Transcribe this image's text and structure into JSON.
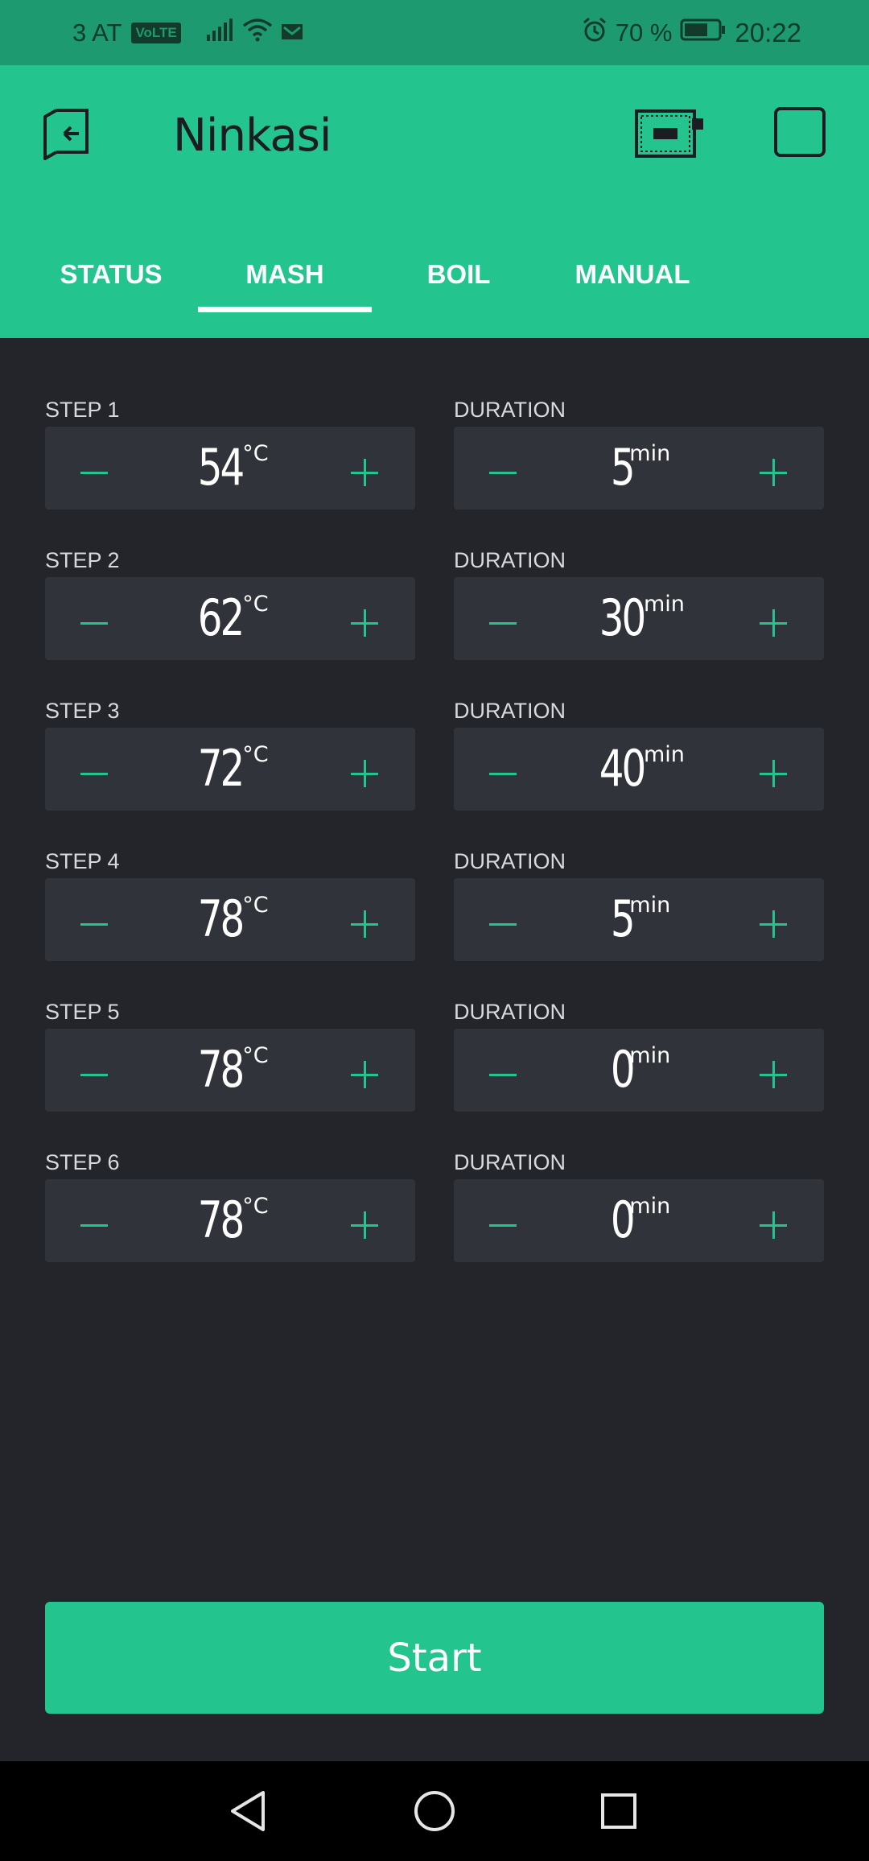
{
  "status_bar": {
    "carrier": "3 AT",
    "volte": "VoLTE",
    "battery": "70 %",
    "time": "20:22"
  },
  "header": {
    "title": "Ninkasi",
    "icons": [
      "exit-icon",
      "device-board-icon",
      "square-icon"
    ]
  },
  "tabs": [
    {
      "label": "STATUS"
    },
    {
      "label": "MASH"
    },
    {
      "label": "BOIL"
    },
    {
      "label": "MANUAL"
    }
  ],
  "active_tab": "MASH",
  "steps": [
    {
      "label": "STEP 1",
      "temp": "54",
      "temp_unit": "°C",
      "duration_label": "DURATION",
      "duration": "5",
      "duration_unit": "min"
    },
    {
      "label": "STEP 2",
      "temp": "62",
      "temp_unit": "°C",
      "duration_label": "DURATION",
      "duration": "30",
      "duration_unit": "min"
    },
    {
      "label": "STEP 3",
      "temp": "72",
      "temp_unit": "°C",
      "duration_label": "DURATION",
      "duration": "40",
      "duration_unit": "min"
    },
    {
      "label": "STEP 4",
      "temp": "78",
      "temp_unit": "°C",
      "duration_label": "DURATION",
      "duration": "5",
      "duration_unit": "min"
    },
    {
      "label": "STEP 5",
      "temp": "78",
      "temp_unit": "°C",
      "duration_label": "DURATION",
      "duration": "0",
      "duration_unit": "min"
    },
    {
      "label": "STEP 6",
      "temp": "78",
      "temp_unit": "°C",
      "duration_label": "DURATION",
      "duration": "0",
      "duration_unit": "min"
    }
  ],
  "start_button": {
    "label": "Start"
  },
  "nav": [
    "back-icon",
    "home-icon",
    "recents-icon"
  ],
  "colors": {
    "accent": "#23c48e",
    "status_bar": "#1d9a6f",
    "background": "#23252a",
    "panel": "#31333a"
  }
}
